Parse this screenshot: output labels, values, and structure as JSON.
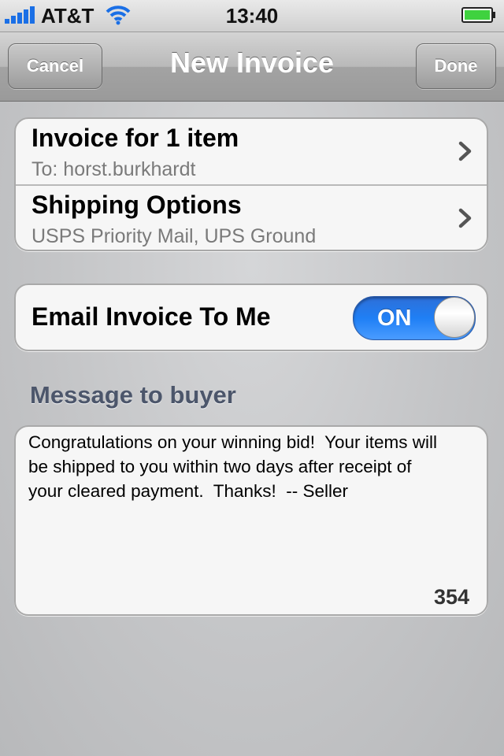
{
  "status_bar": {
    "carrier": "AT&T",
    "time": "13:40",
    "icons": [
      "signal-icon",
      "wifi-icon",
      "battery-icon"
    ],
    "battery_color": "#3fd23f"
  },
  "nav": {
    "cancel_label": "Cancel",
    "title": "New Invoice",
    "done_label": "Done"
  },
  "invoice_group": [
    {
      "title": "Invoice for 1 item",
      "subtitle": "To: horst.burkhardt"
    },
    {
      "title": "Shipping Options",
      "subtitle": "USPS Priority Mail, UPS Ground"
    }
  ],
  "email_toggle": {
    "label": "Email Invoice To Me",
    "state": "ON",
    "accent": "#1f7ff5"
  },
  "message": {
    "header": "Message to buyer",
    "text": "Congratulations on your winning bid!  Your items will\nbe shipped to you within two days after receipt of\nyour cleared payment.  Thanks!  -- Seller",
    "remaining_chars": "354"
  }
}
